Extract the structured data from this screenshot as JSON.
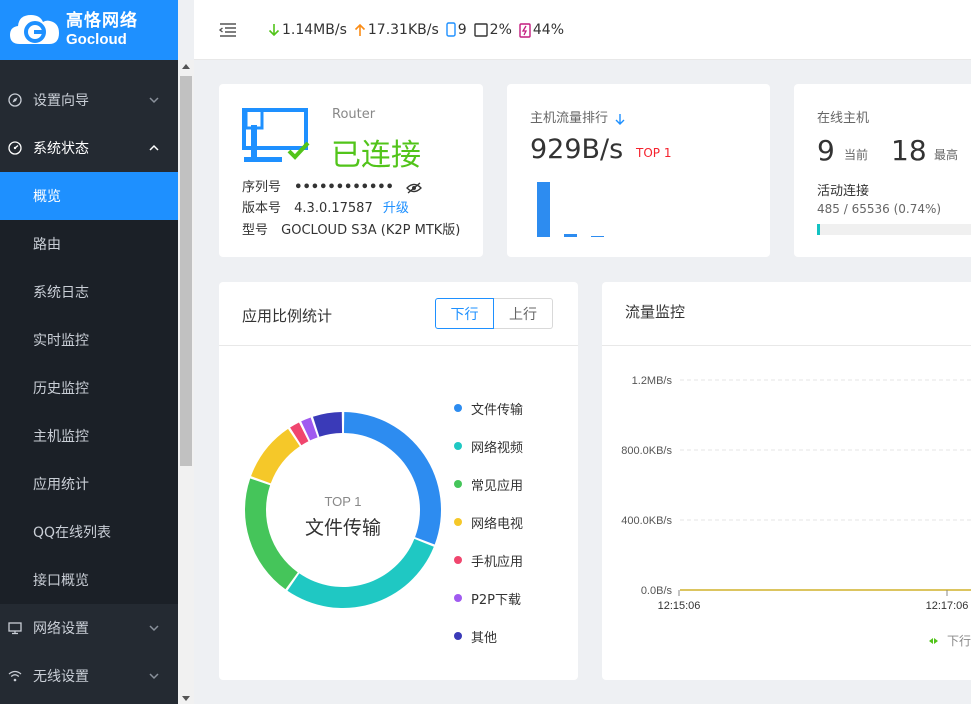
{
  "logo": {
    "name_cn": "高恪网络",
    "name_en": "Gocloud"
  },
  "topbar": {
    "download": "1.14MB/s",
    "upload": "17.31KB/s",
    "devices": "9",
    "cpu": "2%",
    "memory": "44%"
  },
  "sidebar": {
    "items": [
      {
        "label": "设置向导",
        "type": "group",
        "icon": "compass-icon"
      },
      {
        "label": "系统状态",
        "type": "group",
        "icon": "dashboard-icon",
        "open": true
      },
      {
        "label": "概览",
        "type": "sub",
        "active": true
      },
      {
        "label": "路由",
        "type": "sub"
      },
      {
        "label": "系统日志",
        "type": "sub"
      },
      {
        "label": "实时监控",
        "type": "sub"
      },
      {
        "label": "历史监控",
        "type": "sub"
      },
      {
        "label": "主机监控",
        "type": "sub"
      },
      {
        "label": "应用统计",
        "type": "sub"
      },
      {
        "label": "QQ在线列表",
        "type": "sub"
      },
      {
        "label": "接口概览",
        "type": "sub"
      },
      {
        "label": "网络设置",
        "type": "group",
        "icon": "monitor-icon"
      },
      {
        "label": "无线设置",
        "type": "group",
        "icon": "wifi-icon"
      }
    ]
  },
  "router": {
    "label": "Router",
    "status": "已连接",
    "serial_label": "序列号",
    "serial_masked": "••••••••••••",
    "version_label": "版本号",
    "version": "4.3.0.17587",
    "upgrade": "升级",
    "model_label": "型号",
    "model": "GOCLOUD S3A (K2P MTK版)"
  },
  "host_traffic": {
    "title": "主机流量排行",
    "value": "929B/s",
    "tag": "TOP 1",
    "bars": [
      1.0,
      0.06,
      0.02
    ]
  },
  "online_hosts": {
    "title": "在线主机",
    "current": "9",
    "current_label": "当前",
    "max": "18",
    "max_label": "最高",
    "conn_title": "活动连接",
    "conn_value": "485 / 65536 (0.74%)",
    "conn_fraction": 0.0074
  },
  "app_stats": {
    "title": "应用比例统计",
    "tab_down": "下行",
    "tab_up": "上行",
    "center_tag": "TOP 1",
    "center_name": "文件传输",
    "legend": [
      {
        "label": "文件传输",
        "color": "#2d8cf0"
      },
      {
        "label": "网络视频",
        "color": "#1fc8c3"
      },
      {
        "label": "常见应用",
        "color": "#45c55a"
      },
      {
        "label": "网络电视",
        "color": "#f5c829"
      },
      {
        "label": "手机应用",
        "color": "#f0466e"
      },
      {
        "label": "P2P下载",
        "color": "#a05af0"
      },
      {
        "label": "其他",
        "color": "#3a3ab8"
      }
    ],
    "slices": [
      0.3,
      0.28,
      0.2,
      0.1,
      0.02,
      0.02,
      0.05
    ]
  },
  "monitor": {
    "title": "流量监控",
    "y_ticks": [
      "1.2MB/s",
      "800.0KB/s",
      "400.0KB/s",
      "0.0B/s"
    ],
    "x_ticks": [
      "12:15:06",
      "12:17:06"
    ],
    "legend_down": "下行"
  }
}
